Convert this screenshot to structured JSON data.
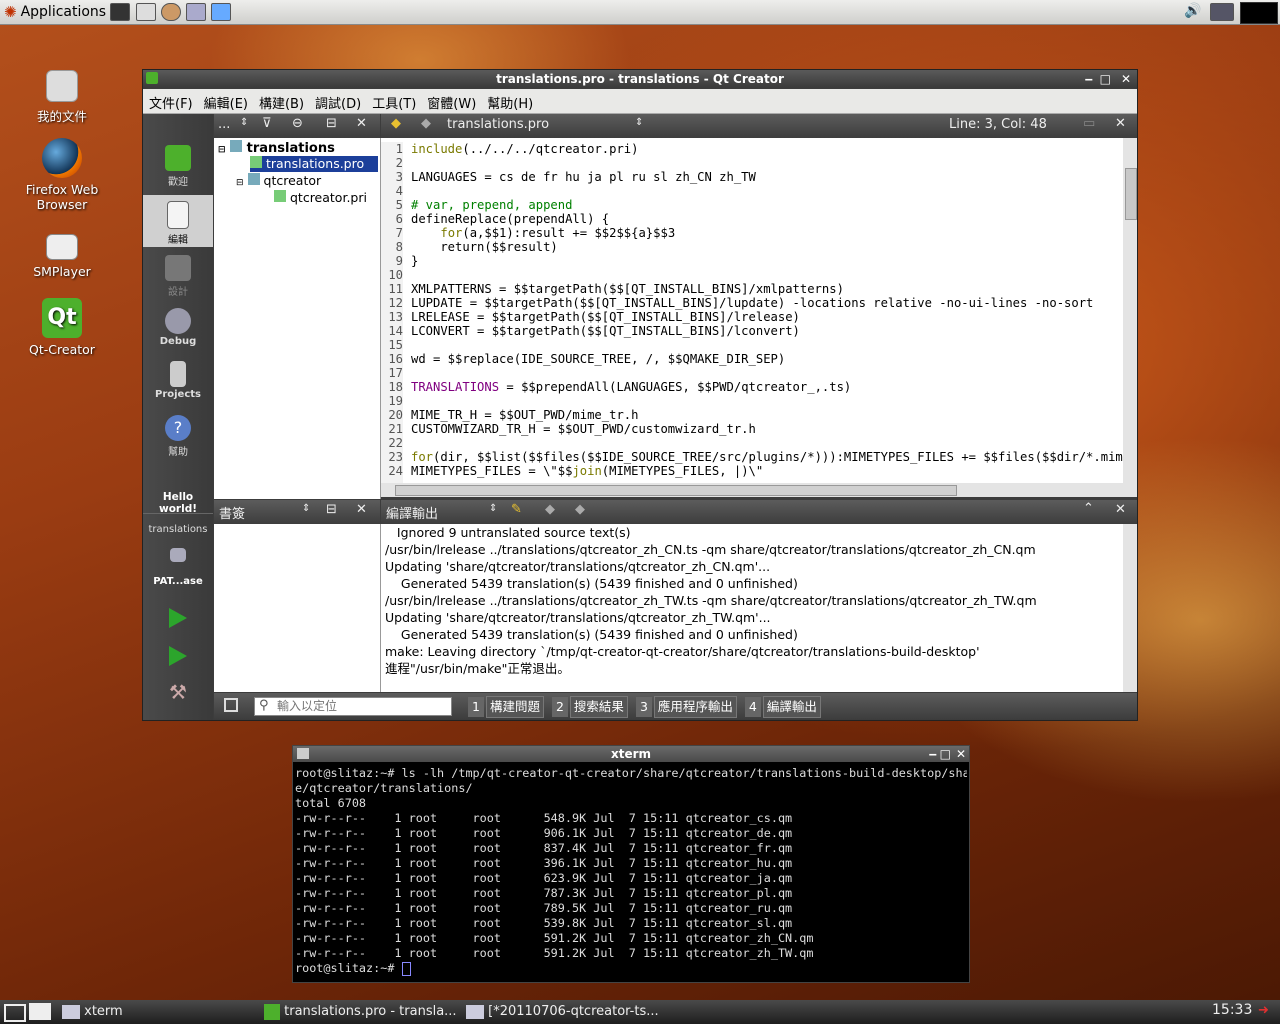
{
  "top_panel": {
    "applications_label": "Applications"
  },
  "desktop_icons": [
    {
      "label": "我的文件"
    },
    {
      "label": "Firefox Web Browser"
    },
    {
      "label": "SMPlayer"
    },
    {
      "label": "Qt-Creator"
    }
  ],
  "qt": {
    "title": "translations.pro - translations - Qt Creator",
    "menu": [
      "文件(F)",
      "編輯(E)",
      "構建(B)",
      "調試(D)",
      "工具(T)",
      "窗體(W)",
      "幫助(H)"
    ],
    "modes": [
      {
        "label": "歡迎"
      },
      {
        "label": "編輯"
      },
      {
        "label": "設計"
      },
      {
        "label": "Debug"
      },
      {
        "label": "Projects"
      },
      {
        "label": "幫助"
      }
    ],
    "hello_label": "Hello world!",
    "target_project": "translations",
    "target_build": "PAT...ase",
    "tree_toolbar_dots": "...",
    "tree": [
      {
        "label": "translations"
      },
      {
        "label": "translations.pro"
      },
      {
        "label": "qtcreator"
      },
      {
        "label": "qtcreator.pri"
      }
    ],
    "editor": {
      "file": "translations.pro",
      "position": "Line: 3, Col: 48",
      "line_numbers": [
        "1",
        "2",
        "3",
        "4",
        "5",
        "6",
        "7",
        "8",
        "9",
        "10",
        "11",
        "12",
        "13",
        "14",
        "15",
        "16",
        "17",
        "18",
        "19",
        "20",
        "21",
        "22",
        "23",
        "24"
      ]
    },
    "bookmarks_label": "書簽",
    "compile_output": {
      "label": "編譯輸出",
      "lines": [
        "   Ignored 9 untranslated source text(s)",
        "/usr/bin/lrelease ../translations/qtcreator_zh_CN.ts -qm share/qtcreator/translations/qtcreator_zh_CN.qm",
        "Updating 'share/qtcreator/translations/qtcreator_zh_CN.qm'...",
        "    Generated 5439 translation(s) (5439 finished and 0 unfinished)",
        "/usr/bin/lrelease ../translations/qtcreator_zh_TW.ts -qm share/qtcreator/translations/qtcreator_zh_TW.qm",
        "Updating 'share/qtcreator/translations/qtcreator_zh_TW.qm'...",
        "    Generated 5439 translation(s) (5439 finished and 0 unfinished)",
        "make: Leaving directory `/tmp/qt-creator-qt-creator/share/qtcreator/translations-build-desktop'",
        "進程\"/usr/bin/make\"正常退出。"
      ]
    },
    "locator_placeholder": "輸入以定位",
    "bottom_tabs": [
      {
        "num": "1",
        "label": "構建問題"
      },
      {
        "num": "2",
        "label": "搜索結果"
      },
      {
        "num": "3",
        "label": "應用程序輸出"
      },
      {
        "num": "4",
        "label": "編譯輸出"
      }
    ]
  },
  "xterm": {
    "title": "xterm",
    "lines": [
      "root@slitaz:~# ls -lh /tmp/qt-creator-qt-creator/share/qtcreator/translations-build-desktop/shar",
      "e/qtcreator/translations/",
      "total 6708",
      "-rw-r--r--    1 root     root      548.9K Jul  7 15:11 qtcreator_cs.qm",
      "-rw-r--r--    1 root     root      906.1K Jul  7 15:11 qtcreator_de.qm",
      "-rw-r--r--    1 root     root      837.4K Jul  7 15:11 qtcreator_fr.qm",
      "-rw-r--r--    1 root     root      396.1K Jul  7 15:11 qtcreator_hu.qm",
      "-rw-r--r--    1 root     root      623.9K Jul  7 15:11 qtcreator_ja.qm",
      "-rw-r--r--    1 root     root      787.3K Jul  7 15:11 qtcreator_pl.qm",
      "-rw-r--r--    1 root     root      789.5K Jul  7 15:11 qtcreator_ru.qm",
      "-rw-r--r--    1 root     root      539.8K Jul  7 15:11 qtcreator_sl.qm",
      "-rw-r--r--    1 root     root      591.2K Jul  7 15:11 qtcreator_zh_CN.qm",
      "-rw-r--r--    1 root     root      591.2K Jul  7 15:11 qtcreator_zh_TW.qm",
      "root@slitaz:~# "
    ]
  },
  "taskbar": {
    "tasks": [
      {
        "label": "xterm"
      },
      {
        "label": "translations.pro - transla..."
      },
      {
        "label": "[*20110706-qtcreator-ts..."
      }
    ],
    "clock": "15:33"
  },
  "colors": {
    "selection": "#1c3f9a",
    "accent_green": "#2ca52c"
  }
}
